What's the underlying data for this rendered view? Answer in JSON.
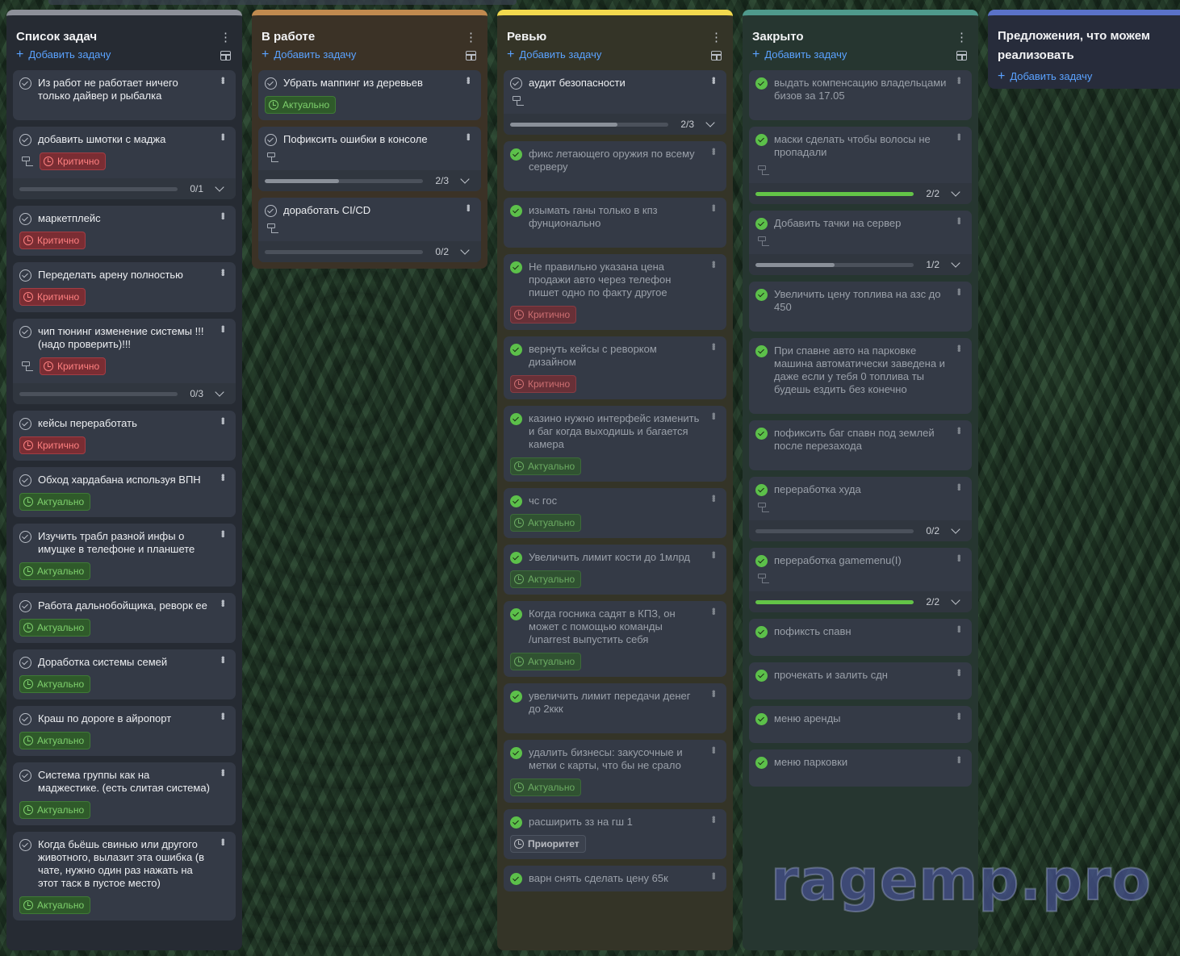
{
  "columns": [
    {
      "id": "todo",
      "title": "Список задач",
      "add_label": "Добавить задачу",
      "color": "#8d9099",
      "bg": "#262b33",
      "cards": [
        {
          "title": "Из работ не работает ничего только дайвер и рыбалка",
          "done": false,
          "extra": true
        },
        {
          "title": "добавить шмотки с маджа",
          "done": false,
          "subtasks": true,
          "badge": "Критично",
          "badge_type": "crit",
          "progress": "0/1",
          "pct": 0,
          "bar": "gray"
        },
        {
          "title": "маркетплейс",
          "done": false,
          "badge": "Критично",
          "badge_type": "crit"
        },
        {
          "title": "Переделать арену полностью",
          "done": false,
          "badge": "Критично",
          "badge_type": "crit"
        },
        {
          "title": "чип тюнинг изменение системы !!!(надо проверить)!!!",
          "done": false,
          "subtasks": true,
          "badge": "Критично",
          "badge_type": "crit",
          "progress": "0/3",
          "pct": 0,
          "bar": "gray"
        },
        {
          "title": "кейсы переработать",
          "done": false,
          "badge": "Критично",
          "badge_type": "crit"
        },
        {
          "title": "Обход хардабана используя ВПН",
          "done": false,
          "badge": "Актуально",
          "badge_type": "act"
        },
        {
          "title": "Изучить трабл разной инфы о имущке в телефоне и планшете",
          "done": false,
          "badge": "Актуально",
          "badge_type": "act"
        },
        {
          "title": "Работа дальнобойщика, реворк ее",
          "done": false,
          "badge": "Актуально",
          "badge_type": "act"
        },
        {
          "title": "Доработка системы семей",
          "done": false,
          "badge": "Актуально",
          "badge_type": "act"
        },
        {
          "title": "Краш по дороге в айропорт",
          "done": false,
          "badge": "Актуально",
          "badge_type": "act"
        },
        {
          "title": "Система группы как на маджестике. (есть слитая система)",
          "done": false,
          "badge": "Актуально",
          "badge_type": "act"
        },
        {
          "title": "Когда бьёшь свинью или другого животного, вылазит эта ошибка (в чате, нужно один раз нажать на этот таск в пустое место)",
          "done": false,
          "badge": "Актуально",
          "badge_type": "act"
        }
      ]
    },
    {
      "id": "inwork",
      "title": "В работе",
      "add_label": "Добавить задачу",
      "color": "#c08a4f",
      "bg": "#3b3226",
      "cards": [
        {
          "title": "Убрать маппинг из деревьев",
          "done": false,
          "badge": "Актуально",
          "badge_type": "act"
        },
        {
          "title": "Пофиксить ошибки в консоле",
          "done": false,
          "subtasks": true,
          "progress": "2/3",
          "pct": 0.47,
          "bar": "gray"
        },
        {
          "title": "доработать CI/CD",
          "done": false,
          "subtasks": true,
          "progress": "0/2",
          "pct": 0,
          "bar": "gray"
        }
      ]
    },
    {
      "id": "review",
      "title": "Ревью",
      "add_label": "Добавить задачу",
      "color": "#f2d94e",
      "bg": "#343427",
      "cards": [
        {
          "title": "аудит безопасности",
          "done": false,
          "subtasks": true,
          "progress": "2/3",
          "pct": 0.68,
          "bar": "gray"
        },
        {
          "title": "фикс летающего оружия по всему серверу",
          "done": true,
          "extra": true
        },
        {
          "title": "изымать ганы только в кпз фунционально",
          "done": true,
          "extra": true
        },
        {
          "title": "Не правильно указана цена продажи авто через телефон пишет одно по факту другое",
          "done": true,
          "badge": "Критично",
          "badge_type": "crit"
        },
        {
          "title": "вернуть кейсы с реворком дизайном",
          "done": true,
          "badge": "Критично",
          "badge_type": "crit"
        },
        {
          "title": "казино нужно интерфейс изменить и баг когда выходишь и багается камера",
          "done": true,
          "badge": "Актуально",
          "badge_type": "act"
        },
        {
          "title": "чс гос",
          "done": true,
          "badge": "Актуально",
          "badge_type": "act"
        },
        {
          "title": "Увеличить лимит кости до 1млрд",
          "done": true,
          "badge": "Актуально",
          "badge_type": "act"
        },
        {
          "title": "Когда госника садят в КПЗ, он может с помощью команды /unarrest выпустить себя",
          "done": true,
          "badge": "Актуально",
          "badge_type": "act"
        },
        {
          "title": "увеличить лимит передачи денег до 2ккк",
          "done": true,
          "extra": true
        },
        {
          "title": "удалить бизнесы: закусочные и метки с карты, что бы не срало",
          "done": true,
          "badge": "Актуально",
          "badge_type": "act"
        },
        {
          "title": "расширить зз на гш 1",
          "done": true,
          "badge": "Приоритет",
          "badge_type": "prio"
        },
        {
          "title": "варн снять сделать цену 65к",
          "done": true
        }
      ]
    },
    {
      "id": "closed",
      "title": "Закрыто",
      "add_label": "Добавить задачу",
      "color": "#4f9a8c",
      "bg": "#263630",
      "cards": [
        {
          "title": "выдать компенсацию владельцами бизов за 17.05",
          "done": true,
          "extra": true
        },
        {
          "title": "маски сделать чтобы волосы не пропадали",
          "done": true,
          "subtasks": true,
          "progress": "2/2",
          "pct": 1,
          "bar": "green"
        },
        {
          "title": "Добавить тачки на сервер",
          "done": true,
          "subtasks": true,
          "progress": "1/2",
          "pct": 0.5,
          "bar": "gray"
        },
        {
          "title": "Увеличить цену топлива на азс до 450",
          "done": true,
          "extra": true
        },
        {
          "title": "При спавне авто на парковке машина автоматически заведена и даже если у тебя 0 топлива ты будешь ездить без конечно",
          "done": true,
          "extra": true
        },
        {
          "title": "пофиксить баг спавн под землей после перезахода",
          "done": true,
          "extra": true
        },
        {
          "title": "переработка худа",
          "done": true,
          "subtasks": true,
          "progress": "0/2",
          "pct": 0,
          "bar": "gray"
        },
        {
          "title": "переработка gamemenu(I)",
          "done": true,
          "subtasks": true,
          "progress": "2/2",
          "pct": 1,
          "bar": "green"
        },
        {
          "title": "пофикcть спавн",
          "done": true,
          "extra": true
        },
        {
          "title": "прочекать и залить сдн",
          "done": true,
          "extra": true
        },
        {
          "title": "меню аренды",
          "done": true,
          "extra": true
        },
        {
          "title": "меню парковки",
          "done": true,
          "extra": true
        }
      ]
    },
    {
      "id": "proposals",
      "title": "Предложения, что можем реализовать",
      "add_label": "Добавить задачу",
      "color": "#5a72c8",
      "bg": "#272c3b",
      "cards": []
    }
  ],
  "watermark": "ragemp.pro"
}
